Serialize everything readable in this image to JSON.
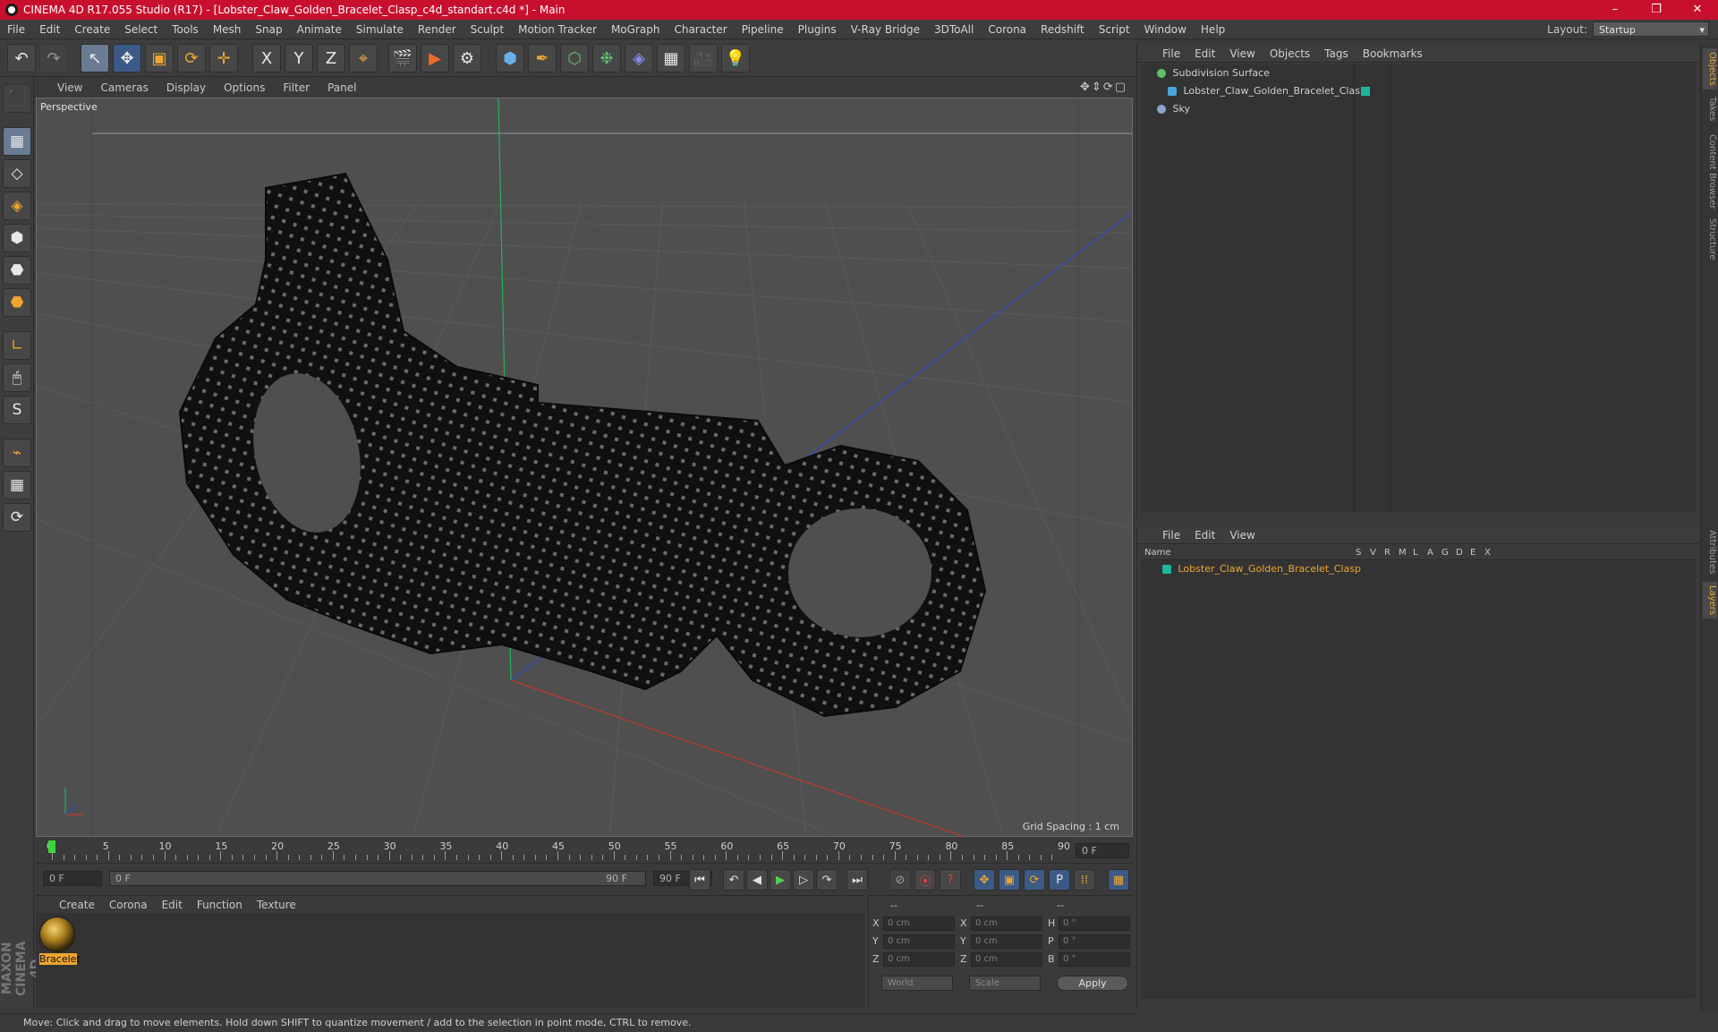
{
  "window": {
    "title": "CINEMA 4D R17.055 Studio (R17) - [Lobster_Claw_Golden_Bracelet_Clasp_c4d_standart.c4d *] - Main",
    "minimize": "–",
    "restore": "❐",
    "close": "✕"
  },
  "menubar": {
    "items": [
      "File",
      "Edit",
      "Create",
      "Select",
      "Tools",
      "Mesh",
      "Snap",
      "Animate",
      "Simulate",
      "Render",
      "Sculpt",
      "Motion Tracker",
      "MoGraph",
      "Character",
      "Pipeline",
      "Plugins",
      "V-Ray Bridge",
      "3DToAll",
      "Corona",
      "Redshift",
      "Script",
      "Window",
      "Help"
    ],
    "layout_label": "Layout:",
    "layout_value": "Startup"
  },
  "toolbar": {
    "undo": "↶",
    "redo": "↷",
    "select": "↖",
    "move": "✥",
    "scale": "▣",
    "rotate": "⟳",
    "last": "✛",
    "x": "X",
    "y": "Y",
    "z": "Z",
    "coord": "⌖",
    "render_view": "🎬",
    "render_pv": "▶",
    "render_settings": "⚙",
    "cube": "⬢",
    "pen": "✒",
    "subdiv": "⬡",
    "mograph": "❉",
    "deformer": "◈",
    "floor": "▦",
    "camera": "🎥",
    "light": "💡"
  },
  "lefttools": [
    "⬛",
    "▦",
    "◇",
    "◈",
    "⬢",
    "⬣",
    "∟",
    "🖱",
    "S",
    "⌁",
    "▦",
    "⟳"
  ],
  "viewport": {
    "menu": [
      "View",
      "Cameras",
      "Display",
      "Options",
      "Filter",
      "Panel"
    ],
    "nav": "✥⇕⟳▢",
    "label": "Perspective",
    "grid_spacing": "Grid Spacing : 1 cm"
  },
  "timeline": {
    "ticks": [
      "0",
      "5",
      "10",
      "15",
      "20",
      "25",
      "30",
      "35",
      "40",
      "45",
      "50",
      "55",
      "60",
      "65",
      "70",
      "75",
      "80",
      "85",
      "90"
    ],
    "end_field": "0 F",
    "start": "0 F",
    "slider_start": "0 F",
    "slider_end": "90 F",
    "end": "90 F"
  },
  "playback": [
    "⏮",
    "↶",
    "◀",
    "▶",
    "▷",
    "↷",
    "⏭"
  ],
  "keytools": [
    "⊘",
    "⦿",
    "?",
    "✥",
    "▣",
    "⟳",
    "P",
    "⁞⁞",
    "▦"
  ],
  "material": {
    "menu": [
      "Create",
      "Corona",
      "Edit",
      "Function",
      "Texture"
    ],
    "name": "Bracelet"
  },
  "coords": {
    "headers": [
      "--",
      "--",
      "--"
    ],
    "rows": [
      {
        "a": "X",
        "av": "0 cm",
        "b": "X",
        "bv": "0 cm",
        "c": "H",
        "cv": "0 °"
      },
      {
        "a": "Y",
        "av": "0 cm",
        "b": "Y",
        "bv": "0 cm",
        "c": "P",
        "cv": "0 °"
      },
      {
        "a": "Z",
        "av": "0 cm",
        "b": "Z",
        "bv": "0 cm",
        "c": "B",
        "cv": "0 °"
      }
    ],
    "world": "World",
    "scale": "Scale",
    "apply": "Apply"
  },
  "status": "Move: Click and drag to move elements. Hold down SHIFT to quantize movement / add to the selection in point mode, CTRL to remove.",
  "objects": {
    "menu": [
      "File",
      "Edit",
      "View",
      "Objects",
      "Tags",
      "Bookmarks"
    ],
    "items": [
      {
        "name": "Subdivision Surface",
        "color": "#5fc26b"
      },
      {
        "name": "Lobster_Claw_Golden_Bracelet_Clasp",
        "color": "#4aa3d8"
      },
      {
        "name": "Sky",
        "color": "#8aa6c8"
      }
    ]
  },
  "layers": {
    "menu": [
      "File",
      "Edit",
      "View"
    ],
    "columns": [
      "Name",
      "S",
      "V",
      "R",
      "M",
      "L",
      "A",
      "G",
      "D",
      "E",
      "X"
    ],
    "items": [
      {
        "name": "Lobster_Claw_Golden_Bracelet_Clasp",
        "color": "#1fb79c"
      }
    ]
  },
  "righttabs": [
    "Objects",
    "Takes",
    "Content Browser",
    "Structure",
    "Attributes",
    "Layers"
  ],
  "maxon": "MAXON CINEMA 4D",
  "colors": {
    "title_bg": "#c8102e",
    "accent": "#f0a530",
    "selected_text": "#f0a530",
    "x_axis": "#c0392b",
    "y_axis": "#27ae60",
    "z_axis": "#2e49c8"
  }
}
